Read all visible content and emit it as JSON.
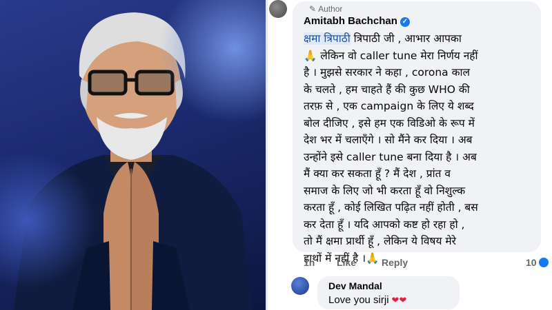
{
  "comment": {
    "author_badge": "Author",
    "author_name": "Amitabh Bachchan",
    "verified_icon": "verified-check-icon",
    "mention": "क्षमा त्रिपाठी",
    "lines": [
      " त्रिपाठी जी , आभार आपका",
      "🙏 लेकिन वो caller tune मेरा निर्णय नहीं",
      "है । मुझसे सरकार ने कहा , corona काल",
      "के चलते , हम चाहते हैं की कुछ WHO की",
      "तरफ़ से , एक campaign के लिए ये शब्द",
      "बोल दीजिए , इसे हम एक विडिओ के रूप में",
      "देश भर में चलाएँगे । सो मैंने  कर दिया । अब",
      "उन्होंने इसे caller tune बना दिया है । अब",
      "मैं  क्या कर सकता हूँ  ? मैं देश , प्रांत व",
      "समाज के लिए जो भी करता हूँ वो निशुल्क",
      "करता हूँ , कोई लिखित पढ़ित नहीं होती , बस",
      "कर देता हूँ  । यदि आपको कष्ट हो रहा हो ,",
      "तो मैं  क्षमा प्रार्थी हूँ , लेकिन ये विषय मेरे",
      "हाथों में नहीं है  ।🙏"
    ],
    "time": "1h",
    "like_label": "Like",
    "reply_label": "Reply",
    "reaction_count": "10"
  },
  "reply": {
    "name": "Dev Mandal",
    "text": "Love you sirji",
    "emoji": "❤❤"
  },
  "colors": {
    "bubble": "#f0f2f5",
    "link": "#1877f2",
    "meta": "#65676b"
  }
}
